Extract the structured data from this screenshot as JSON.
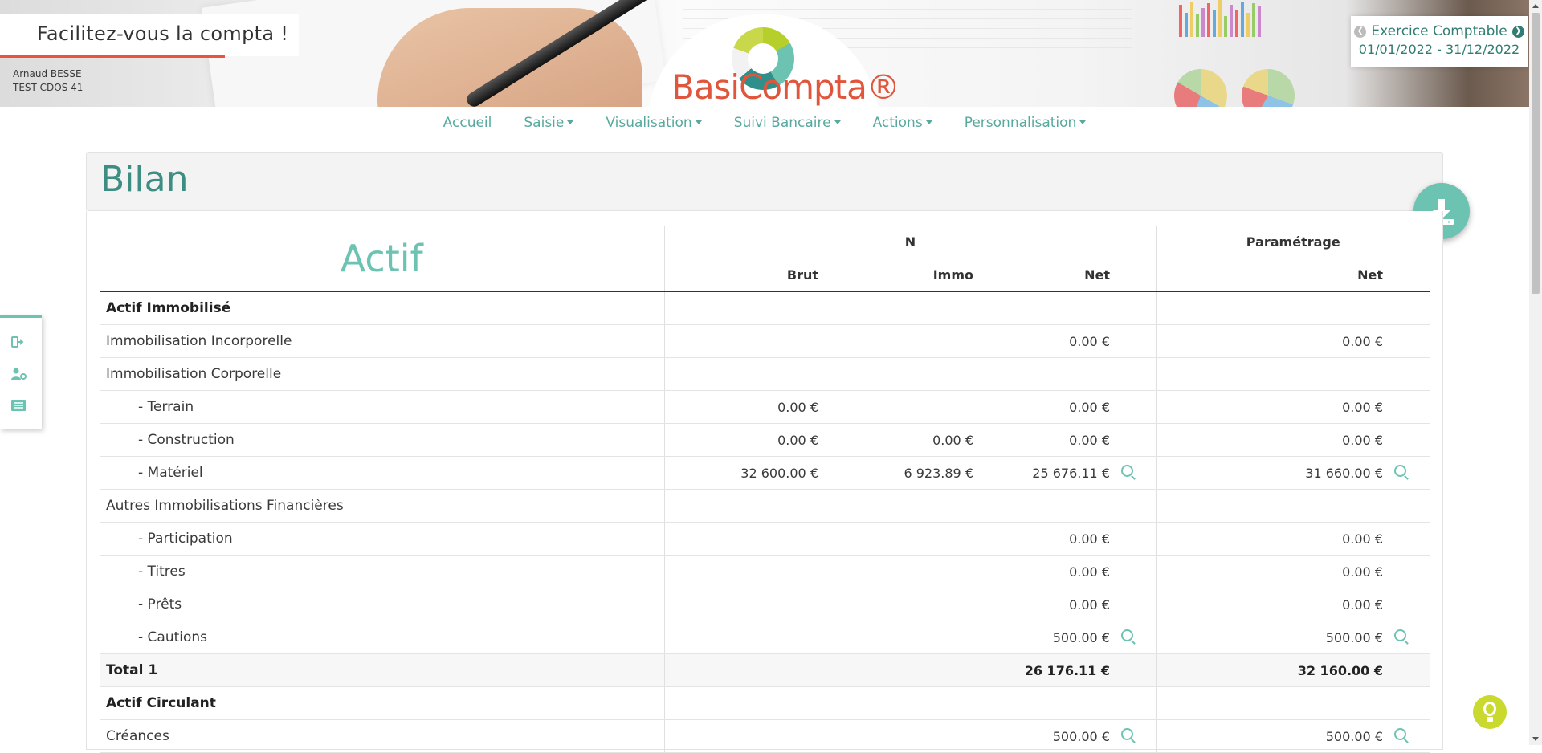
{
  "banner": {
    "tagline": "Facilitez-vous la compta !",
    "user_name": "Arnaud BESSE",
    "user_org": "TEST CDOS 41",
    "logo_text": "BasiCompta®"
  },
  "exercise": {
    "label": "Exercice Comptable",
    "period": "01/01/2022 - 31/12/2022"
  },
  "nav": [
    {
      "label": "Accueil",
      "dropdown": false
    },
    {
      "label": "Saisie",
      "dropdown": true
    },
    {
      "label": "Visualisation",
      "dropdown": true
    },
    {
      "label": "Suivi Bancaire",
      "dropdown": true
    },
    {
      "label": "Actions",
      "dropdown": true
    },
    {
      "label": "Personnalisation",
      "dropdown": true
    }
  ],
  "page": {
    "title": "Bilan"
  },
  "table": {
    "section_title": "Actif",
    "group_n": "N",
    "group_param": "Paramétrage",
    "col_brut": "Brut",
    "col_immo": "Immo",
    "col_net": "Net",
    "col_param_net": "Net",
    "rows": [
      {
        "label": "Actif Immobilisé",
        "type": "section",
        "brut": "",
        "immo": "",
        "net": "",
        "param": "",
        "zoom_net": false,
        "zoom_param": false
      },
      {
        "label": "Immobilisation Incorporelle",
        "type": "item",
        "brut": "",
        "immo": "",
        "net": "0.00 €",
        "param": "0.00 €",
        "zoom_net": false,
        "zoom_param": false
      },
      {
        "label": "Immobilisation Corporelle",
        "type": "item",
        "brut": "",
        "immo": "",
        "net": "",
        "param": "",
        "zoom_net": false,
        "zoom_param": false
      },
      {
        "label": "- Terrain",
        "type": "sub",
        "brut": "0.00 €",
        "immo": "",
        "net": "0.00 €",
        "param": "0.00 €",
        "zoom_net": false,
        "zoom_param": false
      },
      {
        "label": "- Construction",
        "type": "sub",
        "brut": "0.00 €",
        "immo": "0.00 €",
        "net": "0.00 €",
        "param": "0.00 €",
        "zoom_net": false,
        "zoom_param": false
      },
      {
        "label": "- Matériel",
        "type": "sub",
        "brut": "32 600.00 €",
        "immo": "6 923.89 €",
        "net": "25 676.11 €",
        "param": "31 660.00 €",
        "zoom_net": true,
        "zoom_param": true
      },
      {
        "label": "Autres Immobilisations Financières",
        "type": "item",
        "brut": "",
        "immo": "",
        "net": "",
        "param": "",
        "zoom_net": false,
        "zoom_param": false
      },
      {
        "label": "- Participation",
        "type": "sub",
        "brut": "",
        "immo": "",
        "net": "0.00 €",
        "param": "0.00 €",
        "zoom_net": false,
        "zoom_param": false
      },
      {
        "label": "- Titres",
        "type": "sub",
        "brut": "",
        "immo": "",
        "net": "0.00 €",
        "param": "0.00 €",
        "zoom_net": false,
        "zoom_param": false
      },
      {
        "label": "- Prêts",
        "type": "sub",
        "brut": "",
        "immo": "",
        "net": "0.00 €",
        "param": "0.00 €",
        "zoom_net": false,
        "zoom_param": false
      },
      {
        "label": "- Cautions",
        "type": "sub",
        "brut": "",
        "immo": "",
        "net": "500.00 €",
        "param": "500.00 €",
        "zoom_net": true,
        "zoom_param": true
      },
      {
        "label": "Total 1",
        "type": "total",
        "brut": "",
        "immo": "",
        "net": "26 176.11 €",
        "param": "32 160.00 €",
        "zoom_net": false,
        "zoom_param": false
      },
      {
        "label": "Actif Circulant",
        "type": "section",
        "brut": "",
        "immo": "",
        "net": "",
        "param": "",
        "zoom_net": false,
        "zoom_param": false
      },
      {
        "label": "Créances",
        "type": "item",
        "brut": "",
        "immo": "",
        "net": "500.00 €",
        "param": "500.00 €",
        "zoom_net": true,
        "zoom_param": true
      }
    ]
  },
  "colors": {
    "accent": "#6cc3b2",
    "accent_dark": "#3d8d83",
    "logo_red": "#e0563c",
    "bulb": "#c9d92e"
  }
}
